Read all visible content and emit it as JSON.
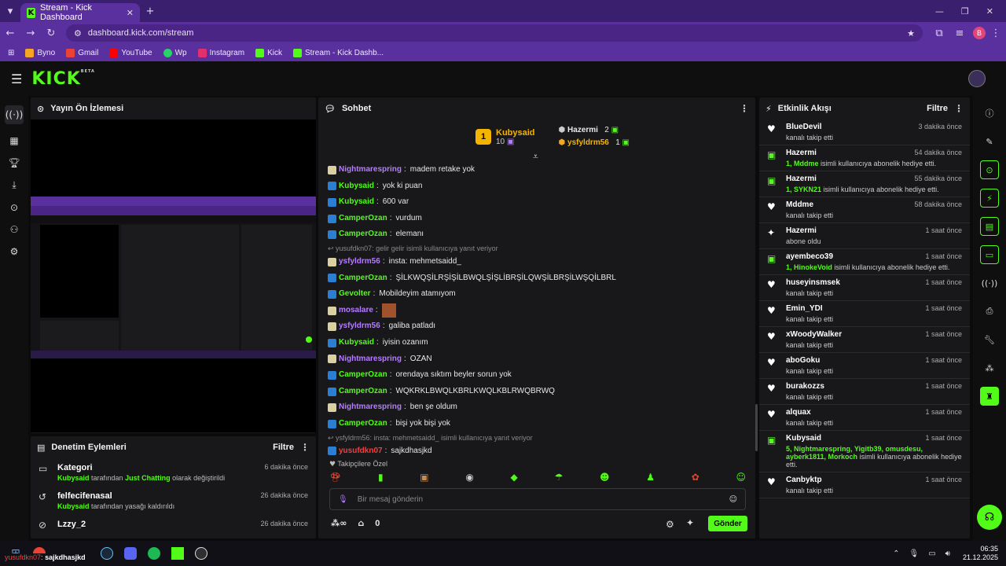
{
  "browser": {
    "tab_title": "Stream - Kick Dashboard",
    "url": "dashboard.kick.com/stream",
    "profile_initial": "B",
    "bookmarks": [
      {
        "label": "Byno",
        "color": "#f6a623"
      },
      {
        "label": "Gmail",
        "color": "#ea4335"
      },
      {
        "label": "YouTube",
        "color": "#ff0000"
      },
      {
        "label": "Wp",
        "color": "#25d366"
      },
      {
        "label": "Instagram",
        "color": "#e1306c"
      },
      {
        "label": "Kick",
        "color": "#53fc18"
      },
      {
        "label": "Stream - Kick Dashb...",
        "color": "#53fc18"
      }
    ]
  },
  "app": {
    "logo": "KICK",
    "beta": "BETA"
  },
  "preview": {
    "title": "Yayın Ön İzlemesi"
  },
  "moderation": {
    "title": "Denetim Eylemleri",
    "filter": "Filtre",
    "items": [
      {
        "icon": "category-icon",
        "title": "Kategori",
        "actor": "Kubysaid",
        "mid": "tarafından",
        "highlight": "Just Chatting",
        "rest": "olarak değiştirildi",
        "time": "6 dakika önce"
      },
      {
        "icon": "undo-icon",
        "title": "felfecifenasal",
        "actor": "Kubysaid",
        "mid": "tarafından yasağı kaldırıldı",
        "highlight": "",
        "rest": "",
        "time": "26 dakika önce"
      },
      {
        "icon": "ban-icon",
        "title": "Lzzy_2",
        "actor": "",
        "mid": "",
        "highlight": "",
        "rest": "",
        "time": "26 dakika önce"
      }
    ]
  },
  "chat": {
    "title": "Sohbet",
    "leaders": {
      "first": {
        "rank": "1",
        "name": "Kubysaid",
        "count": "10"
      },
      "second": {
        "name": "Hazermi",
        "count": "2"
      },
      "third": {
        "name": "ysfyldrm56",
        "count": "1"
      }
    },
    "messages": [
      {
        "user": "Nightmarespring",
        "color": "#b57cff",
        "text": "madem retake yok",
        "reply": ""
      },
      {
        "user": "Kubysaid",
        "color": "#53fc18",
        "text": "yok ki puan",
        "reply": ""
      },
      {
        "user": "Kubysaid",
        "color": "#53fc18",
        "text": "600 var",
        "reply": ""
      },
      {
        "user": "CamperOzan",
        "color": "#53fc18",
        "text": "vurdum",
        "reply": ""
      },
      {
        "user": "CamperOzan",
        "color": "#53fc18",
        "text": "elemanı",
        "reply": ""
      },
      {
        "user": "ysfyldrm56",
        "color": "#b57cff",
        "text": "insta: mehmetsaidd_",
        "reply": "yusufdkn07: gelir gelir isimli kullanıcıya yanıt veriyor"
      },
      {
        "user": "CamperOzan",
        "color": "#53fc18",
        "text": "ŞİLKWQŞİLRŞİŞİLBWQLŞİŞLİBRŞİLQWŞİLBRŞİLWŞQİLBRL",
        "reply": ""
      },
      {
        "user": "Gevolter",
        "color": "#53fc18",
        "text": "Mobildeyim atamıyom",
        "reply": ""
      },
      {
        "user": "mosalare",
        "color": "#b57cff",
        "text": "",
        "reply": ""
      },
      {
        "user": "ysfyldrm56",
        "color": "#b57cff",
        "text": "galiba patladı",
        "reply": ""
      },
      {
        "user": "Kubysaid",
        "color": "#53fc18",
        "text": "iyisin ozanım",
        "reply": ""
      },
      {
        "user": "Nightmarespring",
        "color": "#b57cff",
        "text": "OZAN",
        "reply": ""
      },
      {
        "user": "CamperOzan",
        "color": "#53fc18",
        "text": "orendaya sıktım beyler sorun yok",
        "reply": ""
      },
      {
        "user": "CamperOzan",
        "color": "#53fc18",
        "text": "WQKRKLBWQLKBRLKWQLKBLRWQBRWQ",
        "reply": ""
      },
      {
        "user": "Nightmarespring",
        "color": "#b57cff",
        "text": "ben şe oldum",
        "reply": ""
      },
      {
        "user": "CamperOzan",
        "color": "#53fc18",
        "text": "bişi yok bişi yok",
        "reply": ""
      },
      {
        "user": "yusufdkn07",
        "color": "#ff3b3b",
        "text": "sajkdhasjkd",
        "reply": "ysfyldrm56: insta: mehmetsaidd_ isimli kullanıcıya yanıt veriyor"
      }
    ],
    "follower_only": "Takipçilere Özel",
    "placeholder": "Bir mesaj gönderin",
    "points": "0",
    "send": "Gönder"
  },
  "events": {
    "title": "Etkinlik Akışı",
    "filter": "Filtre",
    "items": [
      {
        "icon": "heart-icon",
        "name": "BlueDevil",
        "time": "3 dakika önce",
        "desc": "kanalı takip etti",
        "hl": ""
      },
      {
        "icon": "gift-icon",
        "name": "Hazermi",
        "time": "54 dakika önce",
        "hl": "1, Mddme",
        "desc": "isimli kullanıcıya abonelik hediye etti."
      },
      {
        "icon": "gift-icon",
        "name": "Hazermi",
        "time": "55 dakika önce",
        "hl": "1, SYKN21",
        "desc": "isimli kullanıcıya abonelik hediye etti."
      },
      {
        "icon": "heart-icon",
        "name": "Mddme",
        "time": "58 dakika önce",
        "desc": "kanalı takip etti",
        "hl": ""
      },
      {
        "icon": "star-icon",
        "name": "Hazermi",
        "time": "1 saat önce",
        "desc": "abone oldu",
        "hl": ""
      },
      {
        "icon": "gift-icon",
        "name": "ayembeco39",
        "time": "1 saat önce",
        "hl": "1, HinokeVoid",
        "desc": "isimli kullanıcıya abonelik hediye etti."
      },
      {
        "icon": "heart-icon",
        "name": "huseyinsmsek",
        "time": "1 saat önce",
        "desc": "kanalı takip etti",
        "hl": ""
      },
      {
        "icon": "heart-icon",
        "name": "Emin_YDI",
        "time": "1 saat önce",
        "desc": "kanalı takip etti",
        "hl": ""
      },
      {
        "icon": "heart-icon",
        "name": "xWoodyWalker",
        "time": "1 saat önce",
        "desc": "kanalı takip etti",
        "hl": ""
      },
      {
        "icon": "heart-icon",
        "name": "aboGoku",
        "time": "1 saat önce",
        "desc": "kanalı takip etti",
        "hl": ""
      },
      {
        "icon": "heart-icon",
        "name": "burakozzs",
        "time": "1 saat önce",
        "desc": "kanalı takip etti",
        "hl": ""
      },
      {
        "icon": "heart-icon",
        "name": "alquax",
        "time": "1 saat önce",
        "desc": "kanalı takip etti",
        "hl": ""
      },
      {
        "icon": "gift-icon",
        "name": "Kubysaid",
        "time": "1 saat önce",
        "hl": "5, Nightmarespring, Yigitb39, omusdesu, ayberk1811, Morkoch",
        "desc": "isimli kullanıcıya abonelik hediye etti."
      },
      {
        "icon": "heart-icon",
        "name": "Canbyktp",
        "time": "1 saat önce",
        "desc": "kanalı takip etti",
        "hl": ""
      }
    ]
  },
  "taskbar": {
    "notify_user": "yusufdkn07",
    "notify_text": "sajkdhasjkd",
    "time": "06:35",
    "date": "21.12.2025"
  }
}
